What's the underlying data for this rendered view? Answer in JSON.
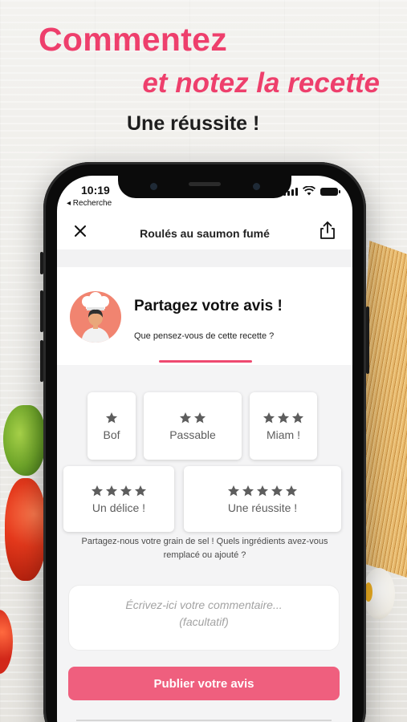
{
  "promo": {
    "title": "Commentez",
    "subtitle": "et notez la recette",
    "tagline": "Une réussite !"
  },
  "status_bar": {
    "time": "10:19",
    "back_label": "◂ Recherche"
  },
  "nav": {
    "title": "Roulés au saumon fumé",
    "close_icon": "close-icon",
    "share_icon": "share-icon"
  },
  "review_header": {
    "title": "Partagez votre avis !",
    "subtitle": "Que pensez-vous de cette recette ?",
    "avatar": "chef-avatar"
  },
  "ratings": [
    {
      "stars": 1,
      "label": "Bof"
    },
    {
      "stars": 2,
      "label": "Passable"
    },
    {
      "stars": 3,
      "label": "Miam !"
    },
    {
      "stars": 4,
      "label": "Un délice !"
    },
    {
      "stars": 5,
      "label": "Une réussite !"
    }
  ],
  "helper_text": "Partagez-nous votre grain de sel ! Quels ingrédients avez-vous remplacé ou ajouté ?",
  "comment": {
    "value": "",
    "placeholder": "Écrivez-ici votre commentaire...\n(facultatif)"
  },
  "publish_button": "Publier votre avis",
  "colors": {
    "accent": "#ee3f6c",
    "button": "#ef5f7e",
    "star": "#5d5d5d",
    "avatar_bg": "#f18470"
  }
}
